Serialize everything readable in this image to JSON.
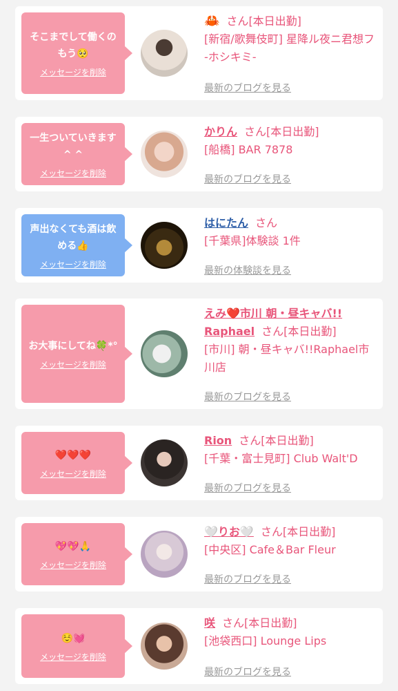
{
  "delete_label": "メッセージを削除",
  "san": "さん",
  "cards": [
    {
      "message": "そこまでして働くのもう🥺",
      "bubble_color": "pink",
      "name": "🦀",
      "status": "[本日出勤]",
      "shop": "[新宿/歌舞伎町] 星降ル夜ニ君想フ -ホシキミ-",
      "link": "最新のブログを見る"
    },
    {
      "message": "一生ついていきます^ ^",
      "bubble_color": "pink",
      "name": "かりん",
      "status": "[本日出勤]",
      "shop": "[船橋] BAR 7878",
      "link": "最新のブログを見る"
    },
    {
      "message": "声出なくても酒は飲める👍",
      "bubble_color": "blue",
      "name": "はにたん",
      "status": "",
      "shop": "[千葉県]体験談 1件",
      "link": "最新の体験談を見る"
    },
    {
      "message": "お大事にしてね🍀*°",
      "bubble_color": "pink",
      "name": "えみ❤️市川 朝・昼キャバ!! Raphael",
      "status": "[本日出勤]",
      "shop": "[市川] 朝・昼キャバ!!Raphael市川店",
      "link": "最新のブログを見る"
    },
    {
      "message": "❤️❤️❤️",
      "bubble_color": "pink",
      "name": "Rion",
      "status": "[本日出勤]",
      "shop": "[千葉・富士見町] Club Walt'D",
      "link": "最新のブログを見る"
    },
    {
      "message": "💖💖🙏",
      "bubble_color": "pink",
      "name": "🤍りお🤍",
      "status": "[本日出勤]",
      "shop": "[中央区] Cafe＆Bar Fleur",
      "link": "最新のブログを見る"
    },
    {
      "message": "☺️💓",
      "bubble_color": "pink",
      "name": "咲",
      "status": "[本日出勤]",
      "shop": "[池袋西口] Lounge Lips",
      "link": "最新のブログを見る"
    }
  ]
}
